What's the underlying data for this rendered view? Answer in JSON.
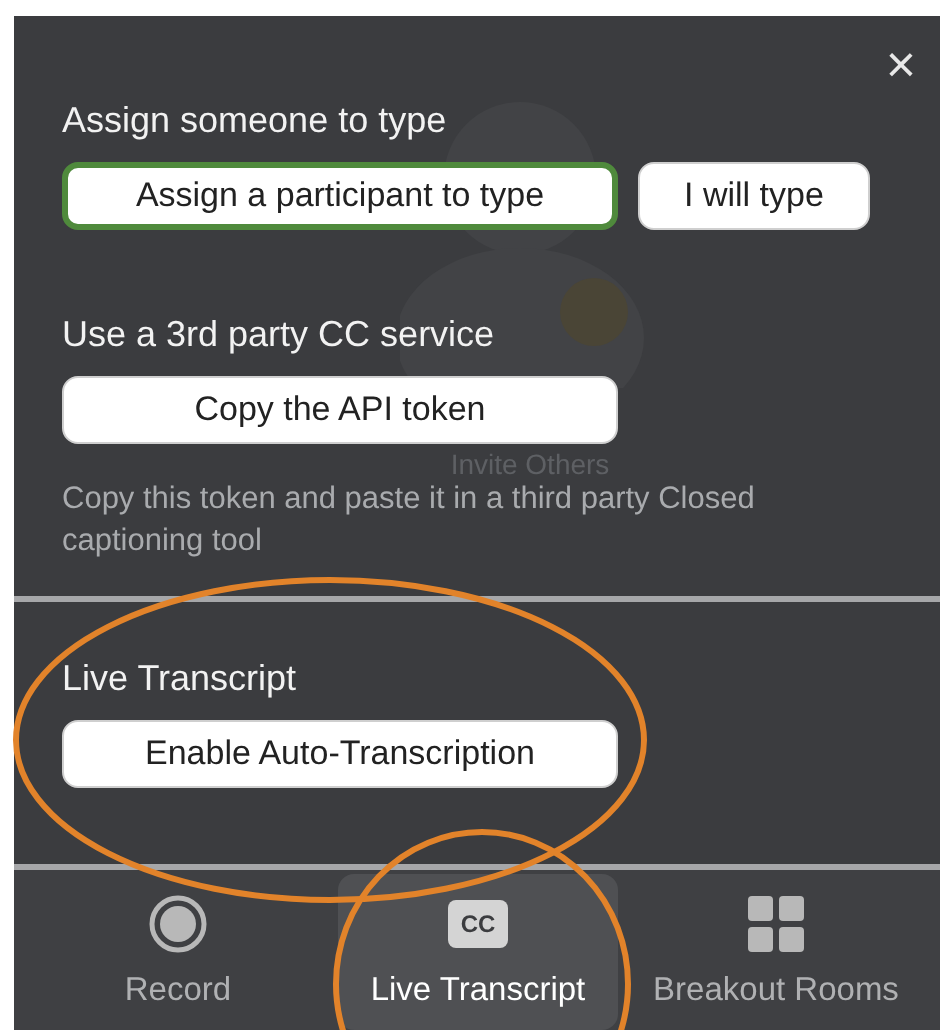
{
  "close_label": "×",
  "background": {
    "label": "Invite Others"
  },
  "sections": [
    {
      "heading": "Assign someone to type",
      "buttons": [
        {
          "label": "Assign a participant to type",
          "selected": true
        },
        {
          "label": "I will type",
          "selected": false
        }
      ]
    },
    {
      "heading": "Use a 3rd party CC service",
      "buttons": [
        {
          "label": "Copy the API token",
          "selected": false
        }
      ],
      "note": "Copy this token and paste it in a third party Closed captioning tool"
    },
    {
      "heading": "Live Transcript",
      "buttons": [
        {
          "label": "Enable Auto-Transcription",
          "selected": false
        }
      ]
    }
  ],
  "toolbar": [
    {
      "kind": "record",
      "label": "Record",
      "selected": false
    },
    {
      "kind": "cc",
      "icon_text": "CC",
      "label": "Live Transcript",
      "selected": true
    },
    {
      "kind": "grid",
      "label": "Breakout Rooms",
      "selected": false
    }
  ],
  "annotations": [
    {
      "kind": "ellipse"
    },
    {
      "kind": "ellipse"
    }
  ]
}
